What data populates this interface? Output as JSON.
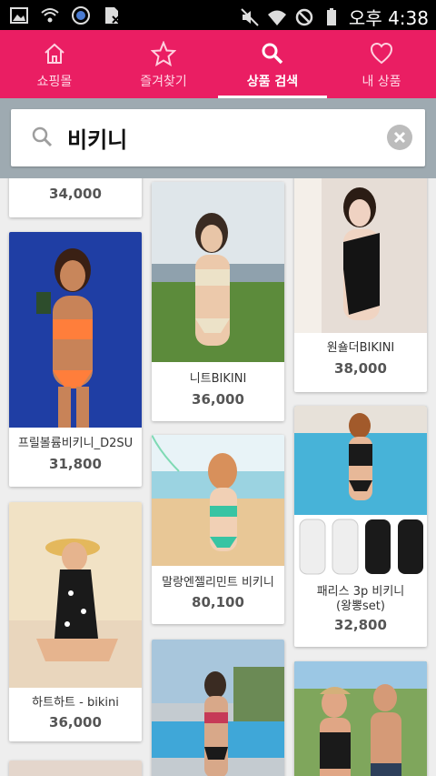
{
  "status_bar": {
    "time": "오후 4:38",
    "icons": [
      "image-icon",
      "wifi-icon",
      "circle-badge-icon",
      "sim-blocked-icon",
      "mute-icon",
      "wifi-icon",
      "no-sign-icon",
      "battery-icon"
    ]
  },
  "tabs": [
    {
      "label": "쇼핑몰",
      "icon": "home-icon",
      "active": false
    },
    {
      "label": "즐겨찾기",
      "icon": "star-icon",
      "active": false
    },
    {
      "label": "상품 검색",
      "icon": "search-icon",
      "active": true
    },
    {
      "label": "내 상품",
      "icon": "heart-icon",
      "active": false
    }
  ],
  "search": {
    "value": "비키니"
  },
  "products": [
    {
      "name": "",
      "price": "34,000"
    },
    {
      "name": "니트BIKINI",
      "price": "36,000"
    },
    {
      "name": "원숄더BIKINI",
      "price": "38,000"
    },
    {
      "name": "프릴볼륨비키니_D2SU",
      "price": "31,800"
    },
    {
      "name": "말랑엔젤리민트 비키니",
      "price": "80,100"
    },
    {
      "name": "패리스 3p 비키니",
      "name2": "(왕뽕set)",
      "price": "32,800"
    },
    {
      "name": "하트하트 - bikini",
      "price": "36,000"
    },
    {
      "name": "",
      "price": ""
    },
    {
      "name": "",
      "price": ""
    }
  ],
  "colors": {
    "accent": "#ea1e63",
    "search_bg": "#9eaab1"
  }
}
